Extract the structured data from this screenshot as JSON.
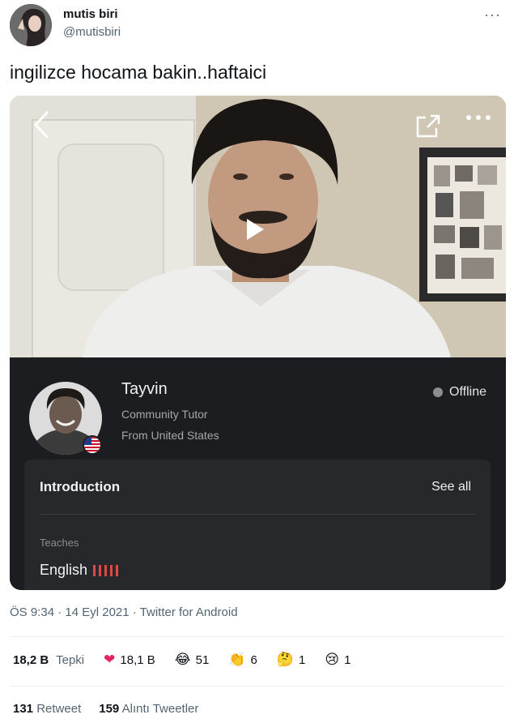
{
  "author": {
    "name": "mutis biri",
    "handle": "@mutisbiri"
  },
  "tweet": {
    "text": "ingilizce hocama bakin..haftaici",
    "meta": "ÖS 9:34 · 14 Eyl 2021 · Twitter for Android"
  },
  "media": {
    "icons": [
      "back-arrow-icon",
      "share-icon",
      "more-dots-icon",
      "play-icon"
    ],
    "tutor": {
      "name": "Tayvin",
      "role": "Community Tutor",
      "from": "From United States",
      "status": "Offline"
    },
    "intro": {
      "title": "Introduction",
      "see_all": "See all",
      "teaches_label": "Teaches",
      "language": "English"
    }
  },
  "reactions": {
    "total": "18,2 B",
    "total_label": "Tepki",
    "items": [
      {
        "icon": "heart-icon",
        "count": "18,1 B",
        "glyph": "❤"
      },
      {
        "icon": "laugh-icon",
        "count": "51",
        "glyph": "😂"
      },
      {
        "icon": "clap-icon",
        "count": "6",
        "glyph": "👏"
      },
      {
        "icon": "thinking-icon",
        "count": "1",
        "glyph": "🤔"
      },
      {
        "icon": "sad-icon",
        "count": "1",
        "glyph": "😢"
      }
    ]
  },
  "stats": {
    "retweets": "131",
    "retweets_label": "Retweet",
    "quotes": "159",
    "quotes_label": "Alıntı Tweetler"
  },
  "colors": {
    "panel": "#1c1d20",
    "card": "#26282c",
    "accent_red": "#e04848",
    "muted": "#536471"
  }
}
